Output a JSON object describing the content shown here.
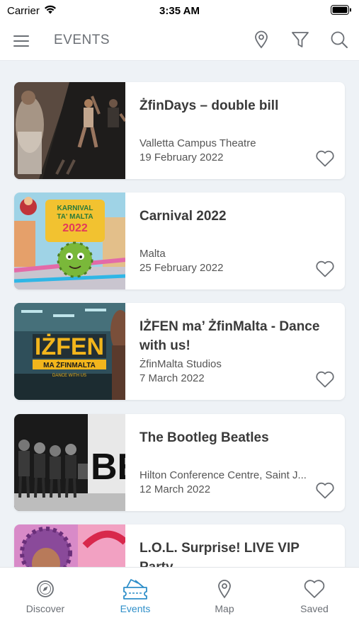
{
  "status_bar": {
    "carrier": "Carrier",
    "time": "3:35 AM"
  },
  "header": {
    "title": "EVENTS",
    "icons": [
      "menu-icon",
      "location-pin-icon",
      "filter-icon",
      "search-icon"
    ]
  },
  "events": [
    {
      "title": "ŻfinDays – double bill",
      "venue": "Valletta Campus Theatre",
      "date": "19 February 2022"
    },
    {
      "title": "Carnival 2022",
      "venue": "Malta",
      "date": "25 February 2022"
    },
    {
      "title": "IŻFEN ma’ ŻfinMalta - Dance with us!",
      "venue": "ŻfinMalta Studios",
      "date": "7 March 2022"
    },
    {
      "title": "The Bootleg Beatles",
      "venue": "Hilton Conference Centre, Saint J...",
      "date": "12 March 2022"
    },
    {
      "title": "L.O.L. Surprise! LIVE VIP Party",
      "venue": "",
      "date": ""
    }
  ],
  "thumbnail_text": {
    "carnival_line1": "KARNIVAL",
    "carnival_line2": "TA' MALTA",
    "carnival_year": "2022",
    "izfen_word": "IŻFEN",
    "izfen_sub": "MA ŻFINMALTA",
    "izfen_tag": "DANCE WITH US",
    "beatles_text": "BE"
  },
  "tabs": [
    {
      "label": "Discover",
      "icon": "compass-icon",
      "active": false
    },
    {
      "label": "Events",
      "icon": "ticket-icon",
      "active": true
    },
    {
      "label": "Map",
      "icon": "map-pin-icon",
      "active": false
    },
    {
      "label": "Saved",
      "icon": "heart-icon",
      "active": false
    }
  ],
  "colors": {
    "accent": "#2f8fc9",
    "icon_gray": "#6b6f75",
    "background": "#eef2f6"
  }
}
